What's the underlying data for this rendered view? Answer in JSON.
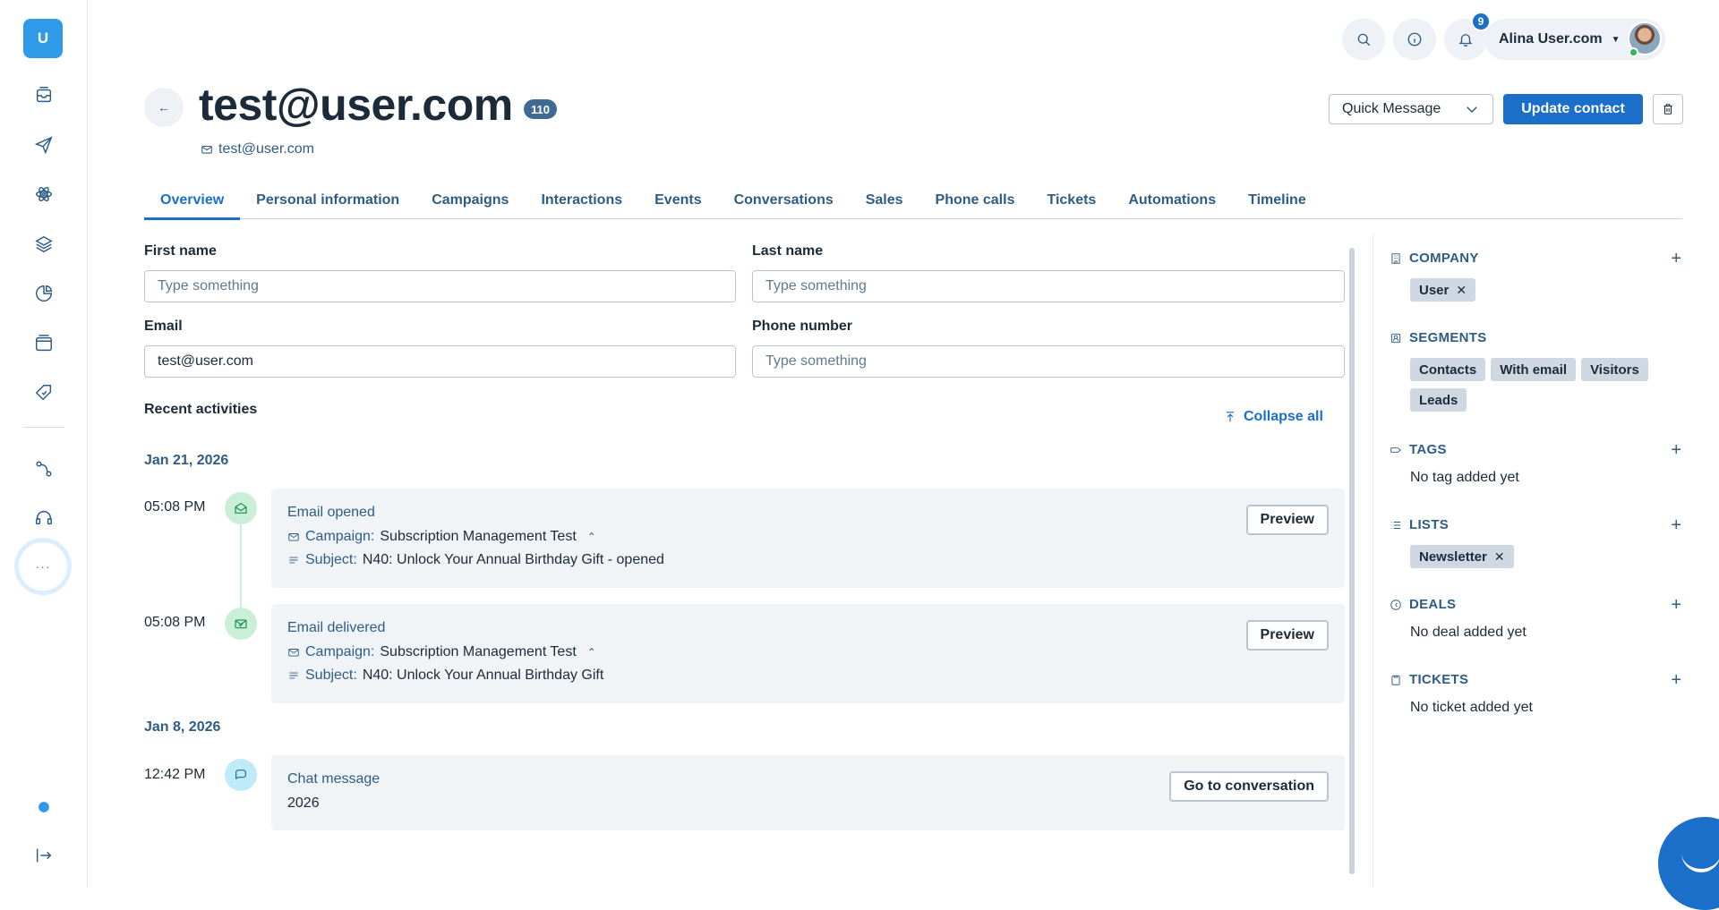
{
  "app": {
    "logo_letter": "U"
  },
  "topbar": {
    "notifications_count": "9",
    "user_name": "Alina User.com"
  },
  "contact": {
    "title": "test@user.com",
    "badge": "110",
    "email": "test@user.com"
  },
  "actions": {
    "quick_message": "Quick Message",
    "update_contact": "Update contact"
  },
  "tabs": [
    {
      "label": "Overview",
      "active": true
    },
    {
      "label": "Personal information"
    },
    {
      "label": "Campaigns"
    },
    {
      "label": "Interactions"
    },
    {
      "label": "Events"
    },
    {
      "label": "Conversations"
    },
    {
      "label": "Sales"
    },
    {
      "label": "Phone calls"
    },
    {
      "label": "Tickets"
    },
    {
      "label": "Automations"
    },
    {
      "label": "Timeline"
    }
  ],
  "form": {
    "first_name_label": "First name",
    "first_name_placeholder": "Type something",
    "last_name_label": "Last name",
    "last_name_placeholder": "Type something",
    "email_label": "Email",
    "email_value": "test@user.com",
    "phone_label": "Phone number",
    "phone_placeholder": "Type something"
  },
  "activities": {
    "title": "Recent activities",
    "collapse_all": "Collapse all",
    "groups": [
      {
        "date": "Jan 21, 2026",
        "items": [
          {
            "time": "05:08 PM",
            "title": "Email opened",
            "campaign_key": "Campaign:",
            "campaign": "Subscription Management Test",
            "subject_key": "Subject:",
            "subject": "N40: Unlock Your Annual Birthday Gift - opened",
            "button": "Preview"
          },
          {
            "time": "05:08 PM",
            "title": "Email delivered",
            "campaign_key": "Campaign:",
            "campaign": "Subscription Management Test",
            "subject_key": "Subject:",
            "subject": "N40: Unlock Your Annual Birthday Gift",
            "button": "Preview"
          }
        ]
      },
      {
        "date": "Jan 8, 2026",
        "items": [
          {
            "time": "12:42 PM",
            "title": "Chat message",
            "body": "2026",
            "button": "Go to conversation"
          }
        ]
      }
    ]
  },
  "right_panel": {
    "company": {
      "heading": "COMPANY",
      "chips": [
        "User"
      ]
    },
    "segments": {
      "heading": "SEGMENTS",
      "chips": [
        "Contacts",
        "With email",
        "Visitors",
        "Leads"
      ]
    },
    "tags": {
      "heading": "TAGS",
      "empty": "No tag added yet"
    },
    "lists": {
      "heading": "LISTS",
      "chips": [
        "Newsletter"
      ]
    },
    "deals": {
      "heading": "DEALS",
      "empty": "No deal added yet"
    },
    "tickets": {
      "heading": "TICKETS",
      "empty": "No ticket added yet"
    }
  },
  "colors": {
    "accent": "#1b6fc9",
    "brand": "#2f9be8",
    "text": "#1c2b3a",
    "muted": "#2f5c86"
  }
}
